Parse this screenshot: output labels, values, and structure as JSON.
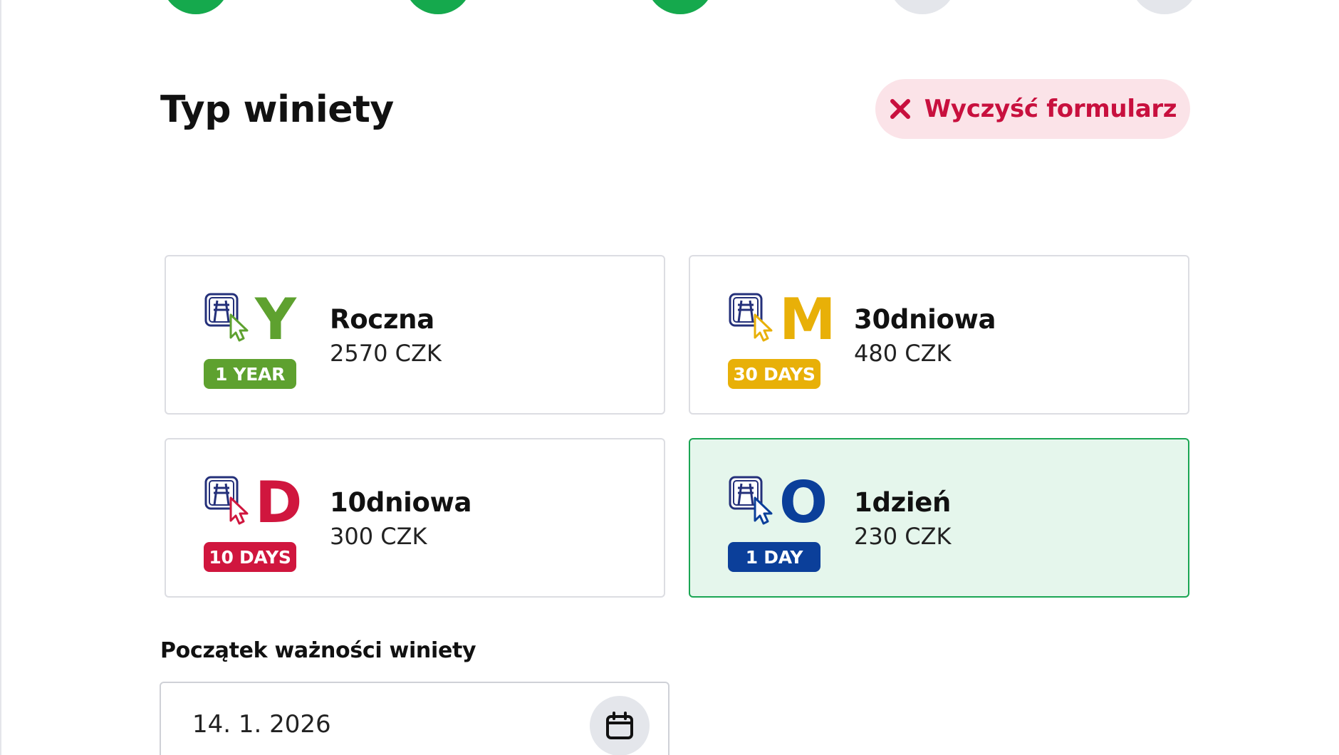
{
  "stepper": {
    "steps": [
      {
        "state": "done"
      },
      {
        "state": "done"
      },
      {
        "state": "done"
      },
      {
        "state": "todo"
      },
      {
        "state": "todo"
      }
    ]
  },
  "header": {
    "title": "Typ winiety",
    "clear_button_label": "Wyczyść formularz",
    "clear_icon": "close-icon"
  },
  "vignettes": [
    {
      "id": "year",
      "letter": "Y",
      "badge": "1 YEAR",
      "name": "Roczna",
      "price": "2570 CZK",
      "color": "#5ea12f",
      "selected": false
    },
    {
      "id": "month",
      "letter": "M",
      "badge": "30 DAYS",
      "name": "30dniowa",
      "price": "480 CZK",
      "color": "#e8b008",
      "selected": false
    },
    {
      "id": "ten-days",
      "letter": "D",
      "badge": "10 DAYS",
      "name": "10dniowa",
      "price": "300 CZK",
      "color": "#d0163e",
      "selected": false
    },
    {
      "id": "one-day",
      "letter": "O",
      "badge": "1 DAY",
      "name": "1dzień",
      "price": "230 CZK",
      "color": "#0b3f9a",
      "selected": true
    }
  ],
  "validity": {
    "label": "Początek ważności winiety",
    "date_value": "14. 1. 2026",
    "calendar_icon": "calendar-icon"
  },
  "colors": {
    "step_done": "#15a94d",
    "step_todo": "#e4e6eb",
    "clear_text": "#c8103e",
    "clear_bg": "#fbe3e8",
    "selected_bg": "#e5f6ec",
    "selected_border": "#1aa553",
    "road_icon_color": "#24307a"
  }
}
